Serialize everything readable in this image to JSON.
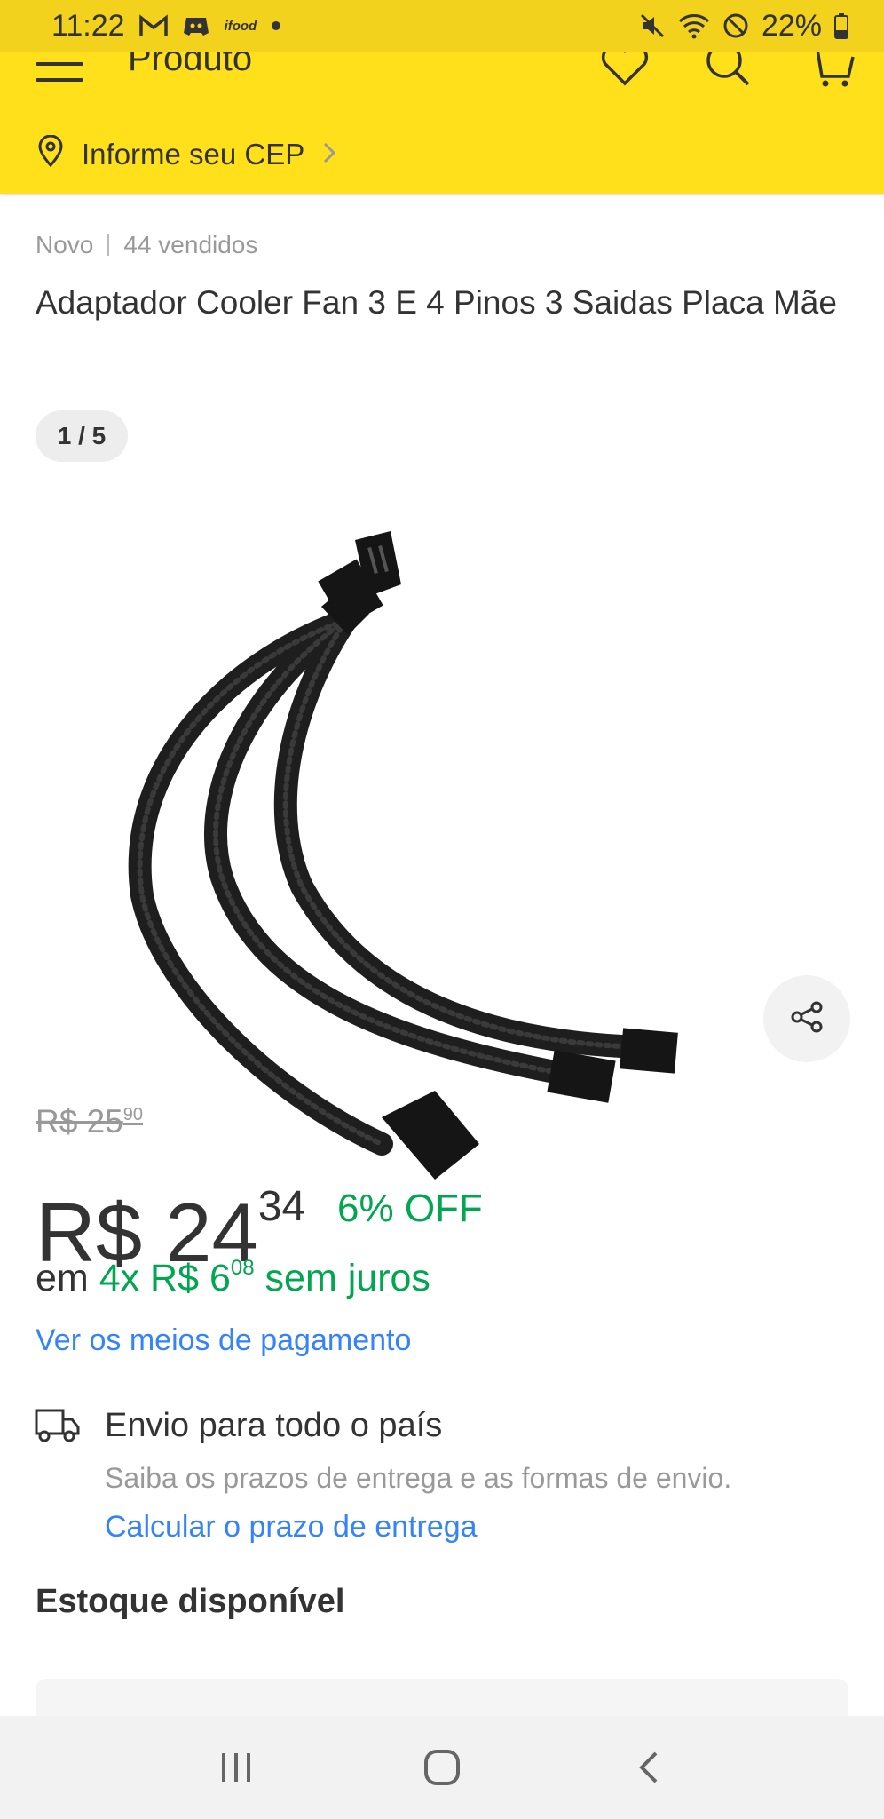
{
  "status_bar": {
    "time": "11:22",
    "left_icons": [
      "gmail-icon",
      "discord-icon",
      "ifood-icon",
      "dot-icon"
    ],
    "ifood_text": "ifood",
    "battery": "22%",
    "right_icons": [
      "mute-icon",
      "wifi-icon",
      "do-not-disturb-icon",
      "battery-icon"
    ]
  },
  "header": {
    "title": "Produto",
    "cep_label": "Informe seu CEP",
    "icons": [
      "menu-icon",
      "heart-icon",
      "search-icon",
      "cart-icon",
      "location-pin-icon",
      "chevron-right-icon"
    ]
  },
  "product": {
    "condition": "Novo",
    "sold": "44 vendidos",
    "title": "Adaptador Cooler Fan 3 E 4 Pinos 3 Saidas Placa Mãe",
    "image_counter": "1 / 5",
    "old_price_main": "R$ 25",
    "old_price_cents": "90",
    "price_main": "R$ 24",
    "price_cents": "34",
    "discount": "6% OFF",
    "installment_prefix": "em",
    "installment_main": "4x R$ 6",
    "installment_cents": "08",
    "installment_suffix": "sem juros",
    "payment_link": "Ver os meios de pagamento"
  },
  "shipping": {
    "title": "Envio para todo o país",
    "subtitle": "Saiba os prazos de entrega e as formas de envio.",
    "link": "Calcular o prazo de entrega"
  },
  "stock": {
    "title": "Estoque disponível"
  },
  "colors": {
    "header_yellow": "#ffe01b",
    "status_yellow": "#f2d21c",
    "green": "#00a650",
    "link_blue": "#3483fa"
  }
}
